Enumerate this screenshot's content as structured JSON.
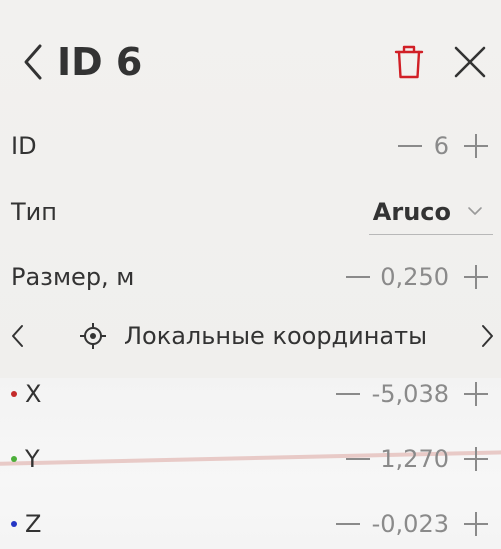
{
  "header": {
    "title": "ID 6",
    "back_icon": "chevron-left-icon",
    "delete_icon": "trash-icon",
    "close_icon": "close-icon",
    "delete_color": "#d11f26"
  },
  "fields": {
    "id": {
      "label": "ID",
      "value": "6"
    },
    "type": {
      "label": "Тип",
      "value": "Aruco"
    },
    "size": {
      "label": "Размер, м",
      "value": "0,250"
    }
  },
  "coordinates": {
    "title": "Локальные координаты",
    "x": {
      "label": "X",
      "value": "-5,038",
      "color": "#c42a2a"
    },
    "y": {
      "label": "Y",
      "value": "1,270",
      "color": "#4caf3a"
    },
    "z": {
      "label": "Z",
      "value": "-0,023",
      "color": "#2536c4"
    }
  },
  "stepper": {
    "minus_icon": "minus-icon",
    "plus_icon": "plus-icon"
  }
}
